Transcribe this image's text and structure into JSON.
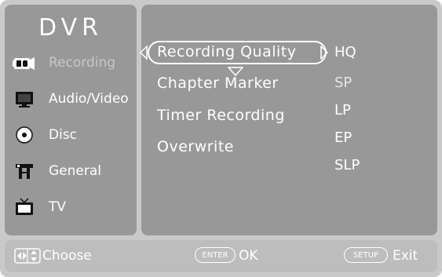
{
  "app": {
    "title": "DVR"
  },
  "sidebar": {
    "items": [
      {
        "label": "Recording",
        "icon": "camcorder-icon",
        "active": true
      },
      {
        "label": "Audio/Video",
        "icon": "monitor-icon",
        "active": false
      },
      {
        "label": "Disc",
        "icon": "disc-icon",
        "active": false
      },
      {
        "label": "General",
        "icon": "tools-icon",
        "active": false
      },
      {
        "label": "TV",
        "icon": "tv-icon",
        "active": false
      }
    ]
  },
  "menu": {
    "items": [
      {
        "label": "Recording Quality",
        "selected": true
      },
      {
        "label": "Chapter Marker",
        "selected": false
      },
      {
        "label": "Timer Recording",
        "selected": false
      },
      {
        "label": "Overwrite",
        "selected": false
      }
    ]
  },
  "options": {
    "items": [
      {
        "label": "HQ",
        "current": true
      },
      {
        "label": "SP",
        "current": false
      },
      {
        "label": "LP",
        "current": false
      },
      {
        "label": "EP",
        "current": false
      },
      {
        "label": "SLP",
        "current": false
      }
    ]
  },
  "footer": {
    "choose": {
      "label": "Choose"
    },
    "enter": {
      "key": "ENTER",
      "label": "OK"
    },
    "setup": {
      "key": "SETUP",
      "label": "Exit"
    }
  },
  "colors": {
    "frame": "#c9c9c9",
    "panel": "#989898",
    "footer": "#bdbdbd",
    "text": "#ffffff"
  }
}
